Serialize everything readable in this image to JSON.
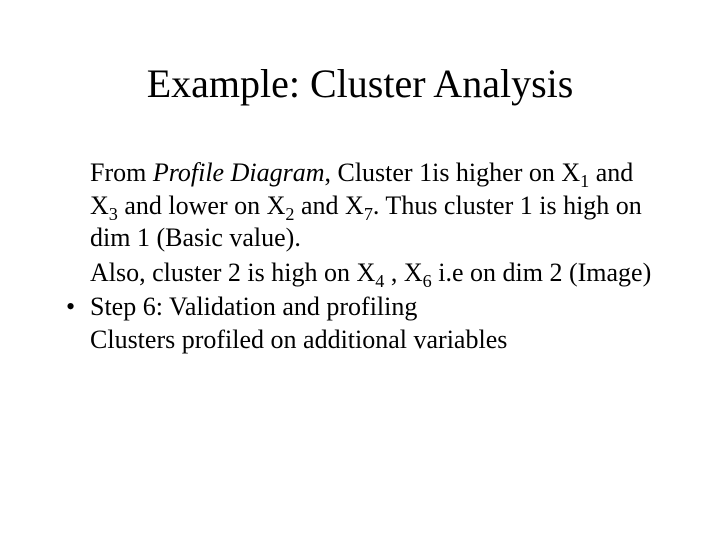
{
  "title": "Example: Cluster Analysis",
  "p1a": "From ",
  "p1b": "Profile Diagram",
  "p1c": ", Cluster 1is higher on X",
  "p1d": " and X",
  "p1e": " and lower on X",
  "p1f": " and X",
  "p1g": ". Thus cluster 1 is high on dim 1 (Basic value).",
  "sub1": "1",
  "sub3": "3",
  "sub2": "2",
  "sub7": "7",
  "p2a": "Also, cluster 2 is high on X",
  "p2b": " , X",
  "p2c": "  i.e on dim 2 (Image)",
  "sub4": "4",
  "sub6": "6",
  "bullet_dot": "•",
  "p3": "Step 6: Validation and profiling",
  "p4": "Clusters profiled on additional variables"
}
